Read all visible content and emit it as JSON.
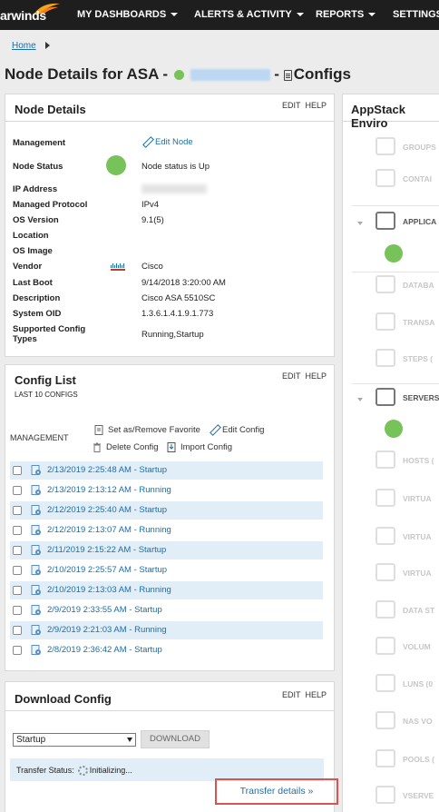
{
  "brand": {
    "name": "arwinds"
  },
  "nav": {
    "items": [
      "MY DASHBOARDS",
      "ALERTS & ACTIVITY",
      "REPORTS",
      "SETTINGS"
    ]
  },
  "breadcrumb": {
    "home": "Home"
  },
  "page": {
    "title_prefix": "Node Details for ASA -",
    "title_sep": "-",
    "title_suffix": "Configs"
  },
  "panel_links": {
    "edit": "EDIT",
    "help": "HELP"
  },
  "node_details": {
    "title": "Node Details",
    "rows": [
      {
        "label": "Management",
        "value": "Edit Node"
      },
      {
        "label": "Node Status",
        "value": "Node status is Up"
      },
      {
        "label": "IP Address",
        "value": ""
      },
      {
        "label": "Managed Protocol",
        "value": "IPv4"
      },
      {
        "label": "OS Version",
        "value": "9.1(5)"
      },
      {
        "label": "Location",
        "value": ""
      },
      {
        "label": "OS Image",
        "value": ""
      },
      {
        "label": "Vendor",
        "value": "Cisco"
      },
      {
        "label": "Last Boot",
        "value": "9/14/2018 3:20:00 AM"
      },
      {
        "label": "Description",
        "value": "Cisco ASA 5510SC"
      },
      {
        "label": "System OID",
        "value": "1.3.6.1.4.1.9.1.773"
      },
      {
        "label": "Supported Config Types",
        "value": "Running,Startup"
      }
    ]
  },
  "config_list": {
    "title": "Config List",
    "subtitle": "LAST 10 CONFIGS",
    "management_label": "MANAGEMENT",
    "actions": {
      "favorite": "Set as/Remove Favorite",
      "edit": "Edit Config",
      "delete": "Delete Config",
      "import": "Import Config"
    },
    "items": [
      "2/13/2019 2:25:48 AM - Startup",
      "2/13/2019 2:13:12 AM - Running",
      "2/12/2019 2:25:40 AM - Startup",
      "2/12/2019 2:13:07 AM - Running",
      "2/11/2019 2:15:22 AM - Startup",
      "2/10/2019 2:25:57 AM - Startup",
      "2/10/2019 2:13:03 AM - Running",
      "2/9/2019 2:33:55 AM - Startup",
      "2/9/2019 2:21:03 AM - Running",
      "2/8/2019 2:36:42 AM - Startup"
    ]
  },
  "download_config": {
    "title": "Download Config",
    "selected_type": "Startup",
    "download_button": "DOWNLOAD",
    "transfer_status_label": "Transfer Status:",
    "transfer_status_value": "Initializing...",
    "transfer_details_link": "Transfer details »"
  },
  "appstack": {
    "title": "AppStack Enviro",
    "items": [
      {
        "label": "GROUPS",
        "icon": "folder-icon"
      },
      {
        "label": "CONTAI",
        "icon": "container-icon"
      },
      {
        "label": "APPLICA",
        "icon": "application-icon"
      },
      {
        "label": "DATABA",
        "icon": "database-icon"
      },
      {
        "label": "TRANSA",
        "icon": "transaction-icon"
      },
      {
        "label": "STEPS (",
        "icon": "steps-icon"
      },
      {
        "label": "SERVERS",
        "icon": "server-icon"
      },
      {
        "label": "HOSTS (",
        "icon": "host-icon"
      },
      {
        "label": "VIRTUA",
        "icon": "virtual-icon"
      },
      {
        "label": "VIRTUA",
        "icon": "virtual-datacenter-icon"
      },
      {
        "label": "VIRTUA",
        "icon": "virtual-cluster-icon"
      },
      {
        "label": "DATA ST",
        "icon": "datastore-icon"
      },
      {
        "label": "VOLUM",
        "icon": "volume-icon"
      },
      {
        "label": "LUNS (0",
        "icon": "lun-icon"
      },
      {
        "label": "NAS VO",
        "icon": "nas-icon"
      },
      {
        "label": "POOLS (",
        "icon": "pool-icon"
      },
      {
        "label": "VSERVE",
        "icon": "vserver-icon"
      }
    ]
  },
  "colors": {
    "status_up": "#77c35a",
    "link": "#1b6ea8",
    "row_alt": "#e1eef8",
    "highlight_box": "#d9534f"
  }
}
